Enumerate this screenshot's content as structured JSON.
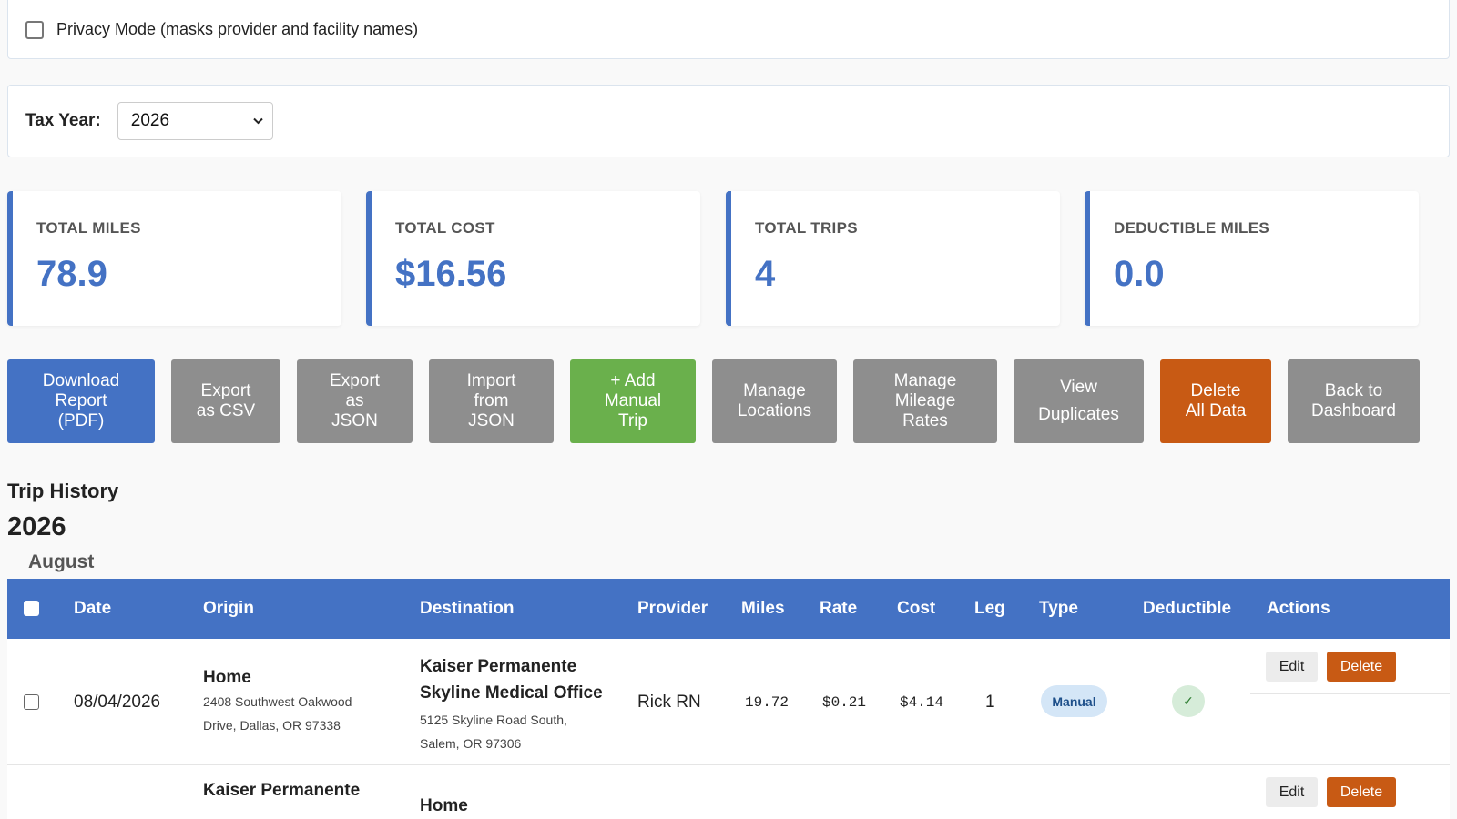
{
  "privacy": {
    "label": "Privacy Mode (masks provider and facility names)",
    "checked": false
  },
  "tax_year": {
    "label": "Tax Year:",
    "selected": "2026"
  },
  "stats": [
    {
      "label": "TOTAL MILES",
      "value": "78.9"
    },
    {
      "label": "TOTAL COST",
      "value": "$16.56"
    },
    {
      "label": "TOTAL TRIPS",
      "value": "4"
    },
    {
      "label": "DEDUCTIBLE MILES",
      "value": "0.0"
    }
  ],
  "actions": {
    "download_pdf": "Download\nReport\n(PDF)",
    "export_csv": "Export\nas CSV",
    "export_json": "Export\nas\nJSON",
    "import_json": "Import\nfrom\nJSON",
    "add_manual": "+ Add\nManual\nTrip",
    "manage_locations": "Manage\nLocations",
    "manage_rates": "Manage\nMileage\nRates",
    "view_duplicates": "View\nDuplicates",
    "delete_all": "Delete\nAll Data",
    "back_dashboard": "Back to\nDashboard"
  },
  "colors": {
    "primary": "#4472c4",
    "neutral_button": "#8e8e8e",
    "success": "#6ab04c",
    "danger": "#c85a14"
  },
  "trip_history": {
    "title": "Trip History",
    "year": "2026",
    "month": "August",
    "columns": [
      "Date",
      "Origin",
      "Destination",
      "Provider",
      "Miles",
      "Rate",
      "Cost",
      "Leg",
      "Type",
      "Deductible",
      "Actions"
    ],
    "rows": [
      {
        "date": "08/04/2026",
        "origin_name": "Home",
        "origin_addr_1": "2408 Southwest Oakwood",
        "origin_addr_2": "Drive, Dallas, OR 97338",
        "dest_name_1": "Kaiser Permanente",
        "dest_name_2": "Skyline Medical Office",
        "dest_addr_1": "5125 Skyline Road South,",
        "dest_addr_2": "Salem, OR 97306",
        "provider": "Rick RN",
        "miles": "19.72",
        "rate": "$0.21",
        "cost": "$4.14",
        "leg": "1",
        "type": "Manual",
        "deductible_icon": "check-icon",
        "deductible_mark": "✓",
        "edit": "Edit",
        "delete": "Delete"
      },
      {
        "origin_name": "Kaiser Permanente",
        "dest_name_1": "Home",
        "edit": "Edit",
        "delete": "Delete"
      }
    ]
  }
}
